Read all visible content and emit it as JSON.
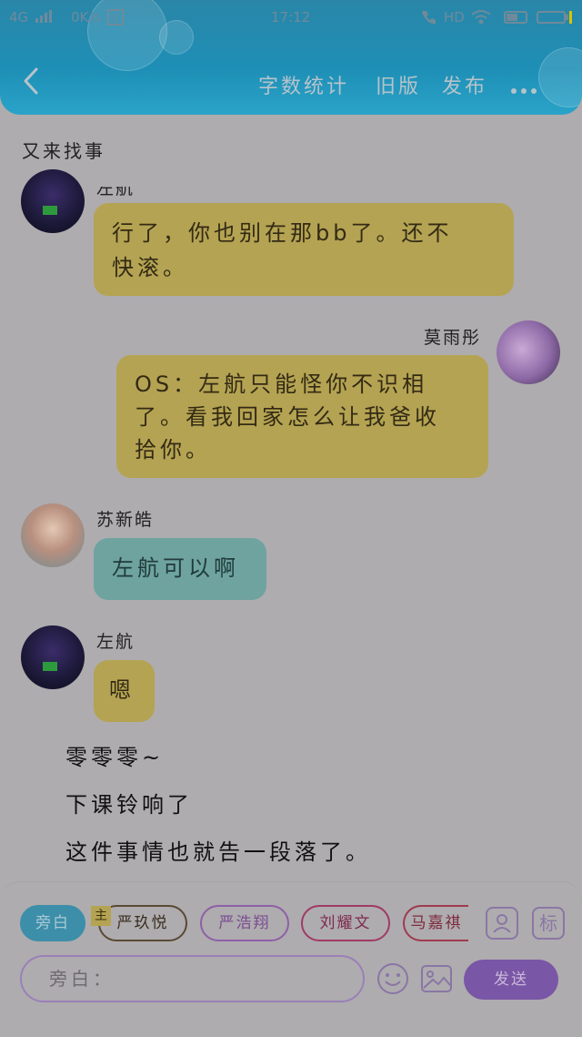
{
  "status_bar": {
    "network": "4G",
    "speed": "0K/s",
    "time": "17:12",
    "volte": "HD"
  },
  "header": {
    "word_count": "字数统计",
    "old_version": "旧版",
    "publish": "发布"
  },
  "chapter_title": "又来找事",
  "messages": [
    {
      "speaker": "左航",
      "text_line1": "行了，你也别在那bb了。还不",
      "text_line2": "快滚。"
    },
    {
      "speaker": "莫雨彤",
      "text_line1": "OS：左航只能怪你不识相",
      "text_line2": "了。看我回家怎么让我爸收",
      "text_line3": "拾你。"
    },
    {
      "speaker": "苏新皓",
      "text_line1": "左航可以啊"
    },
    {
      "speaker": "左航",
      "text_line1": "嗯"
    }
  ],
  "narration": [
    "零零零~",
    "下课铃响了",
    "这件事情也就告一段落了。"
  ],
  "roles": {
    "narrator": "旁白",
    "main_tag": "主",
    "r1": "严玖悦",
    "r2": "严浩翔",
    "r3": "刘耀文",
    "r4": "马嘉祺"
  },
  "input": {
    "label": "旁白：",
    "send": "发送",
    "tag_button": "标"
  },
  "icons": [
    "back-arrow-icon",
    "more-icon",
    "person-icon",
    "emoji-icon",
    "image-icon"
  ],
  "colors": {
    "header": "#1e8fb6",
    "bubble_yellow": "#b4a352",
    "bubble_teal": "#6ea3a0",
    "send": "#7a56a6"
  }
}
